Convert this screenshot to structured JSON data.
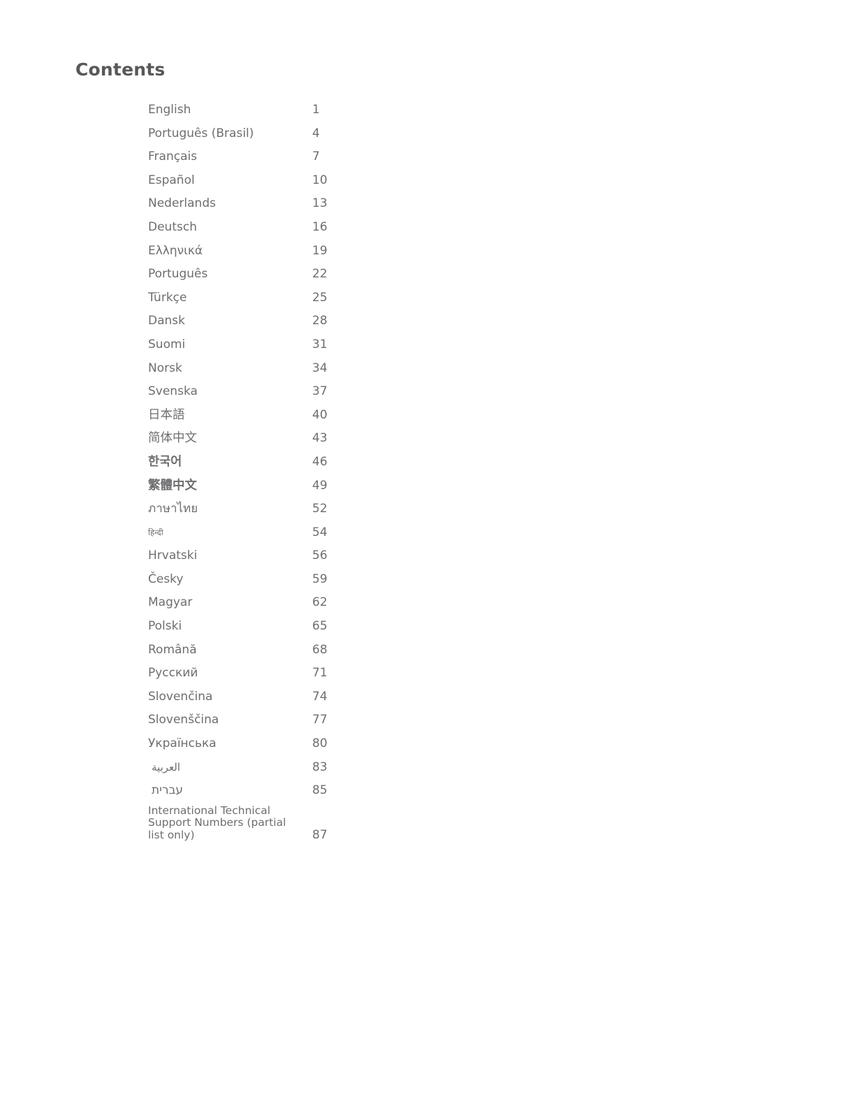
{
  "document": {
    "title": "Contents"
  },
  "contents": {
    "entries": [
      {
        "label": "English",
        "page": "1",
        "script": "latin"
      },
      {
        "label": "Português (Brasil)",
        "page": "4",
        "script": "latin"
      },
      {
        "label": "Français",
        "page": "7",
        "script": "latin"
      },
      {
        "label": "Español",
        "page": "10",
        "script": "latin"
      },
      {
        "label": "Nederlands",
        "page": "13",
        "script": "latin"
      },
      {
        "label": "Deutsch",
        "page": "16",
        "script": "latin"
      },
      {
        "label": "Ελληνικά",
        "page": "19",
        "script": "greek"
      },
      {
        "label": "Português",
        "page": "22",
        "script": "latin"
      },
      {
        "label": "Türkçe",
        "page": "25",
        "script": "latin"
      },
      {
        "label": "Dansk",
        "page": "28",
        "script": "latin"
      },
      {
        "label": "Suomi",
        "page": "31",
        "script": "latin"
      },
      {
        "label": "Norsk",
        "page": "34",
        "script": "latin"
      },
      {
        "label": "Svenska",
        "page": "37",
        "script": "latin"
      },
      {
        "label": "日本語",
        "page": "40",
        "script": "cjk"
      },
      {
        "label": "简体中文",
        "page": "43",
        "script": "cjk"
      },
      {
        "label": "한국어",
        "page": "46",
        "script": "korean"
      },
      {
        "label": "繁體中文",
        "page": "49",
        "script": "tradchinese"
      },
      {
        "label": "ภาษาไทย",
        "page": "52",
        "script": "thai"
      },
      {
        "label": "हिन्दी",
        "page": "54",
        "script": "devanagari"
      },
      {
        "label": "Hrvatski",
        "page": "56",
        "script": "latin"
      },
      {
        "label": "Česky",
        "page": "59",
        "script": "latin"
      },
      {
        "label": "Magyar",
        "page": "62",
        "script": "latin"
      },
      {
        "label": "Polski",
        "page": "65",
        "script": "latin"
      },
      {
        "label": "Română",
        "page": "68",
        "script": "latin"
      },
      {
        "label": "Русский",
        "page": "71",
        "script": "cyrillic"
      },
      {
        "label": "Slovenčina",
        "page": "74",
        "script": "latin"
      },
      {
        "label": "Slovenščina",
        "page": "77",
        "script": "latin"
      },
      {
        "label": "Українська",
        "page": "80",
        "script": "cyrillic"
      },
      {
        "label": "العربية",
        "page": "83",
        "script": "arabic"
      },
      {
        "label": "עברית",
        "page": "85",
        "script": "hebrew"
      },
      {
        "label": "International Technical Support Numbers (partial list only)",
        "page": "87",
        "script": "latin",
        "multiline": true
      }
    ]
  },
  "colors": {
    "heading_text": "#58585a",
    "body_text": "#6d6e70",
    "page_background": "#ffffff"
  }
}
